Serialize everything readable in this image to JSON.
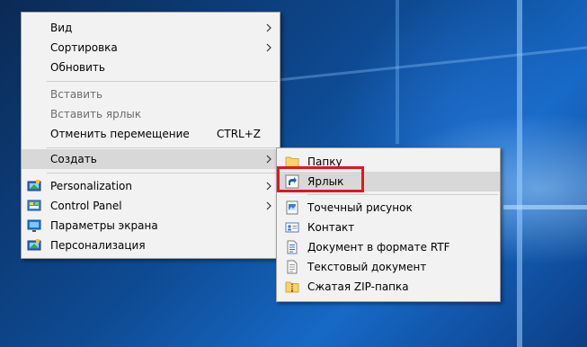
{
  "context_menu": {
    "items": [
      {
        "label": "Вид"
      },
      {
        "label": "Сортировка"
      },
      {
        "label": "Обновить"
      },
      {
        "label": "Вставить"
      },
      {
        "label": "Вставить ярлык"
      },
      {
        "label": "Отменить перемещение",
        "shortcut": "CTRL+Z"
      },
      {
        "label": "Создать"
      },
      {
        "label": "Personalization"
      },
      {
        "label": "Control Panel"
      },
      {
        "label": "Параметры экрана"
      },
      {
        "label": "Персонализация"
      }
    ]
  },
  "submenu": {
    "items": [
      {
        "label": "Папку"
      },
      {
        "label": "Ярлык"
      },
      {
        "label": "Точечный рисунок"
      },
      {
        "label": "Контакт"
      },
      {
        "label": "Документ в формате RTF"
      },
      {
        "label": "Текстовый документ"
      },
      {
        "label": "Сжатая ZIP-папка"
      }
    ]
  }
}
